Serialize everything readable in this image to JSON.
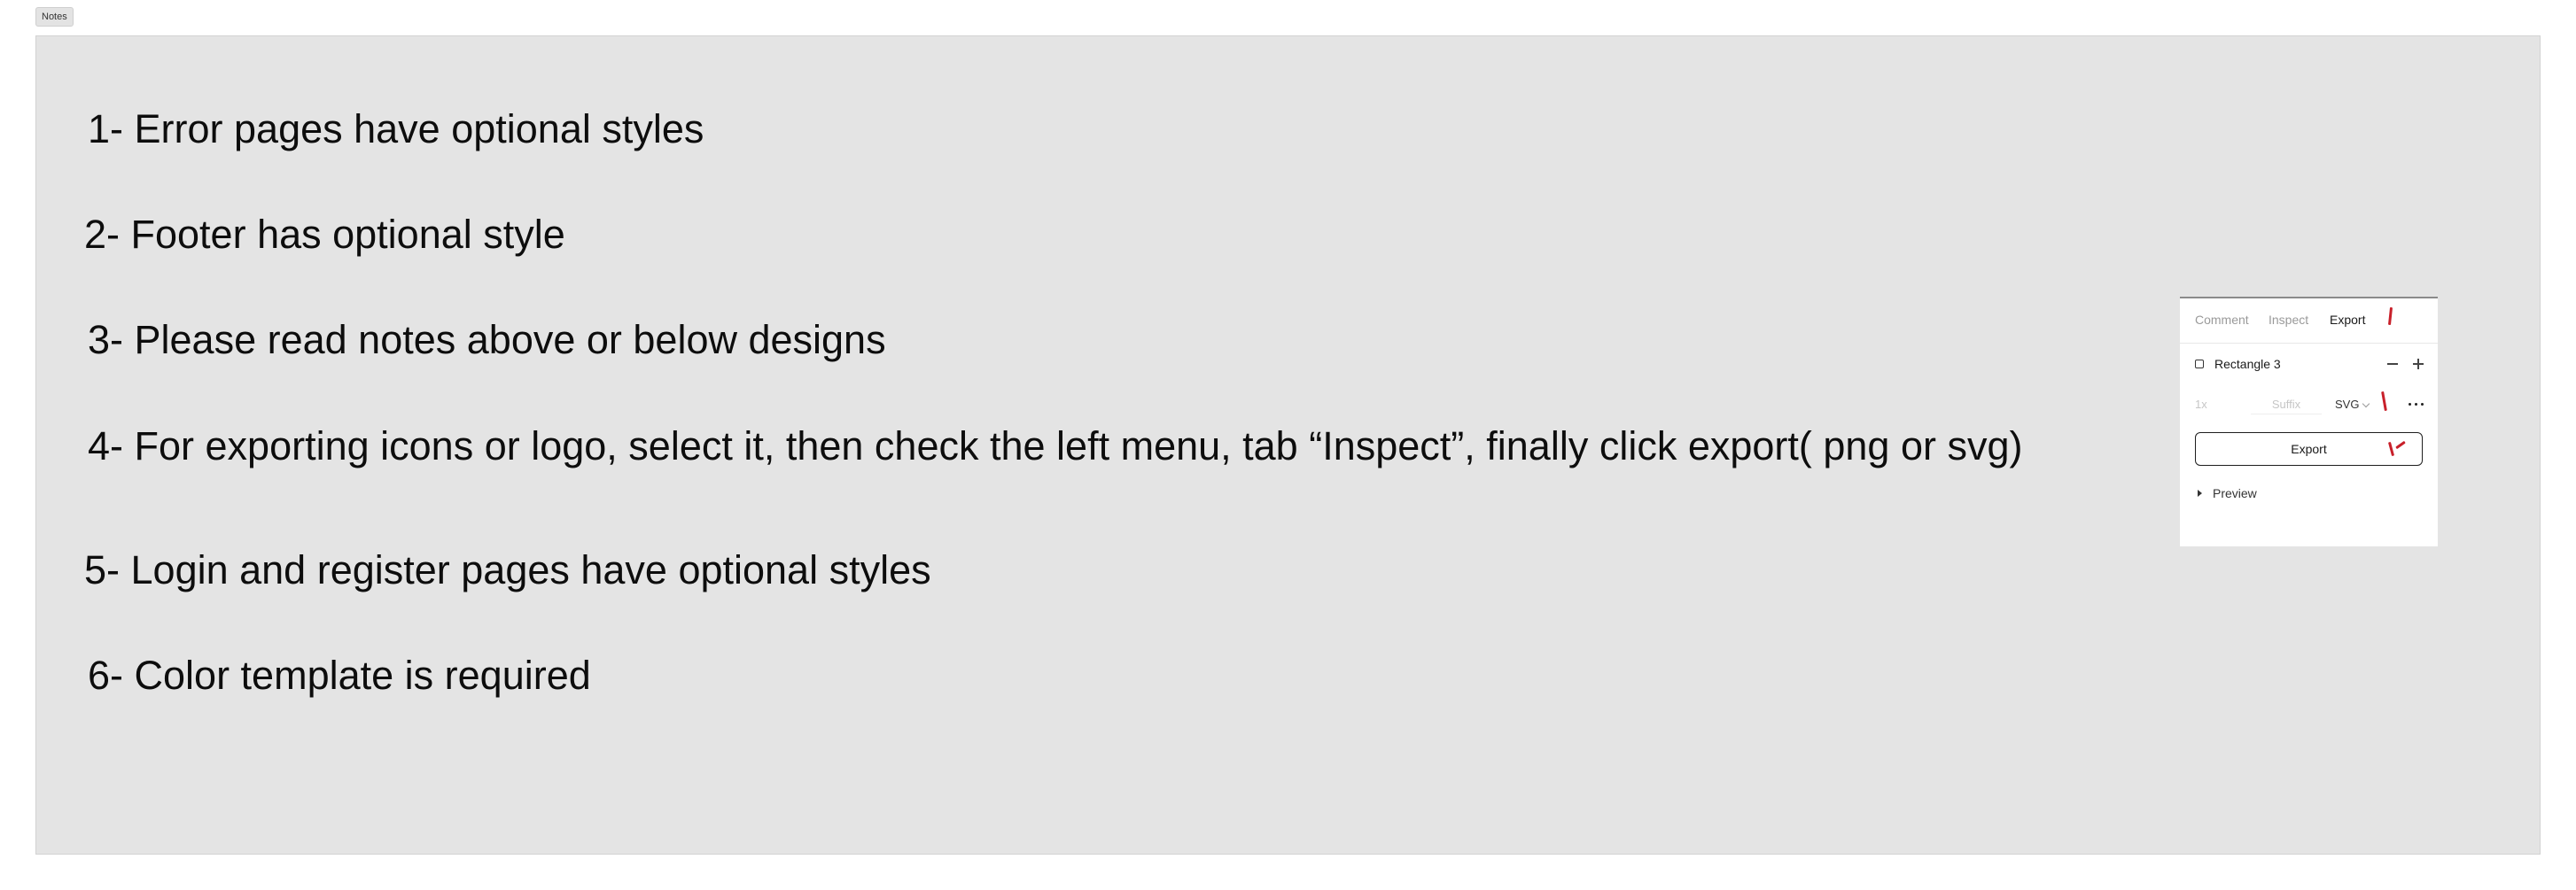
{
  "frame": {
    "label": "Notes"
  },
  "notes": [
    "1- Error pages have optional styles",
    "2- Footer has optional style",
    "3- Please read notes above or below designs",
    "4- For exporting icons or logo, select it, then check the left menu, tab “Inspect”, finally click export( png or svg)",
    "5- Login and register pages have optional styles",
    "6- Color template is required"
  ],
  "panel": {
    "tabs": [
      {
        "label": "Comment",
        "active": false
      },
      {
        "label": "Inspect",
        "active": false
      },
      {
        "label": "Export",
        "active": true
      }
    ],
    "layer": {
      "icon": "rectangle-icon",
      "name": "Rectangle 3"
    },
    "export_settings": {
      "scale_placeholder": "1x",
      "suffix_placeholder": "Suffix",
      "format": "SVG"
    },
    "export_button": "Export",
    "preview_label": "Preview",
    "annotation_color": "#c8202a"
  }
}
